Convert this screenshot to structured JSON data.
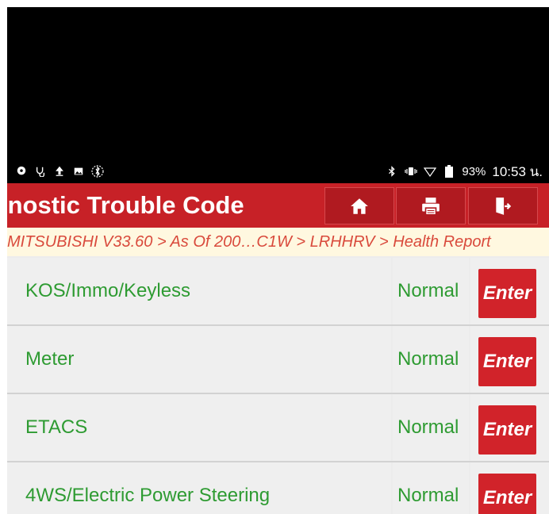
{
  "status_bar": {
    "battery": "93%",
    "time": "10:53 น."
  },
  "header": {
    "title": "ınostic Trouble Code",
    "buttons": [
      {
        "icon": "home-icon"
      },
      {
        "icon": "print-icon"
      },
      {
        "icon": "exit-icon"
      }
    ]
  },
  "breadcrumb": "MITSUBISHI V33.60 > As Of 200…C1W > LRHHRV > Health Report",
  "rows": [
    {
      "name": "KOS/Immo/Keyless",
      "status": "Normal",
      "button": "Enter"
    },
    {
      "name": "Meter",
      "status": "Normal",
      "button": "Enter"
    },
    {
      "name": "ETACS",
      "status": "Normal",
      "button": "Enter"
    },
    {
      "name": "4WS/Electric Power Steering",
      "status": "Normal",
      "button": "Enter"
    }
  ],
  "colors": {
    "header": "#c72127",
    "green_text": "#2e9b32",
    "enter_button": "#d1232a",
    "breadcrumb_text": "#d94a3c"
  }
}
